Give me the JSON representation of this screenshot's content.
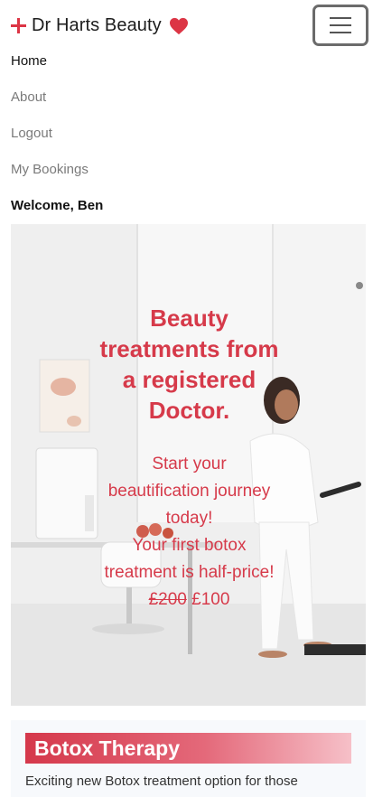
{
  "brand": {
    "name": "Dr Harts Beauty",
    "accent": "#dc3545",
    "icons": [
      "plus-icon",
      "heart-icon"
    ]
  },
  "nav": {
    "toggler_icon": "hamburger-icon",
    "links": [
      "Home",
      "About",
      "Logout",
      "My Bookings"
    ],
    "active": "Home",
    "welcome": "Welcome, Ben"
  },
  "hero": {
    "title_lines": [
      "Beauty",
      "treatments from",
      "a registered",
      "Doctor."
    ],
    "sub_lines": [
      "Start your",
      "beautification journey",
      "today!",
      "Your first botox",
      "treatment is half-price!"
    ],
    "old_price": "£200",
    "new_price": "£100",
    "text_color": "#d63a4a"
  },
  "section": {
    "heading": "Botox Therapy",
    "text": "Exciting new Botox treatment option for those"
  }
}
